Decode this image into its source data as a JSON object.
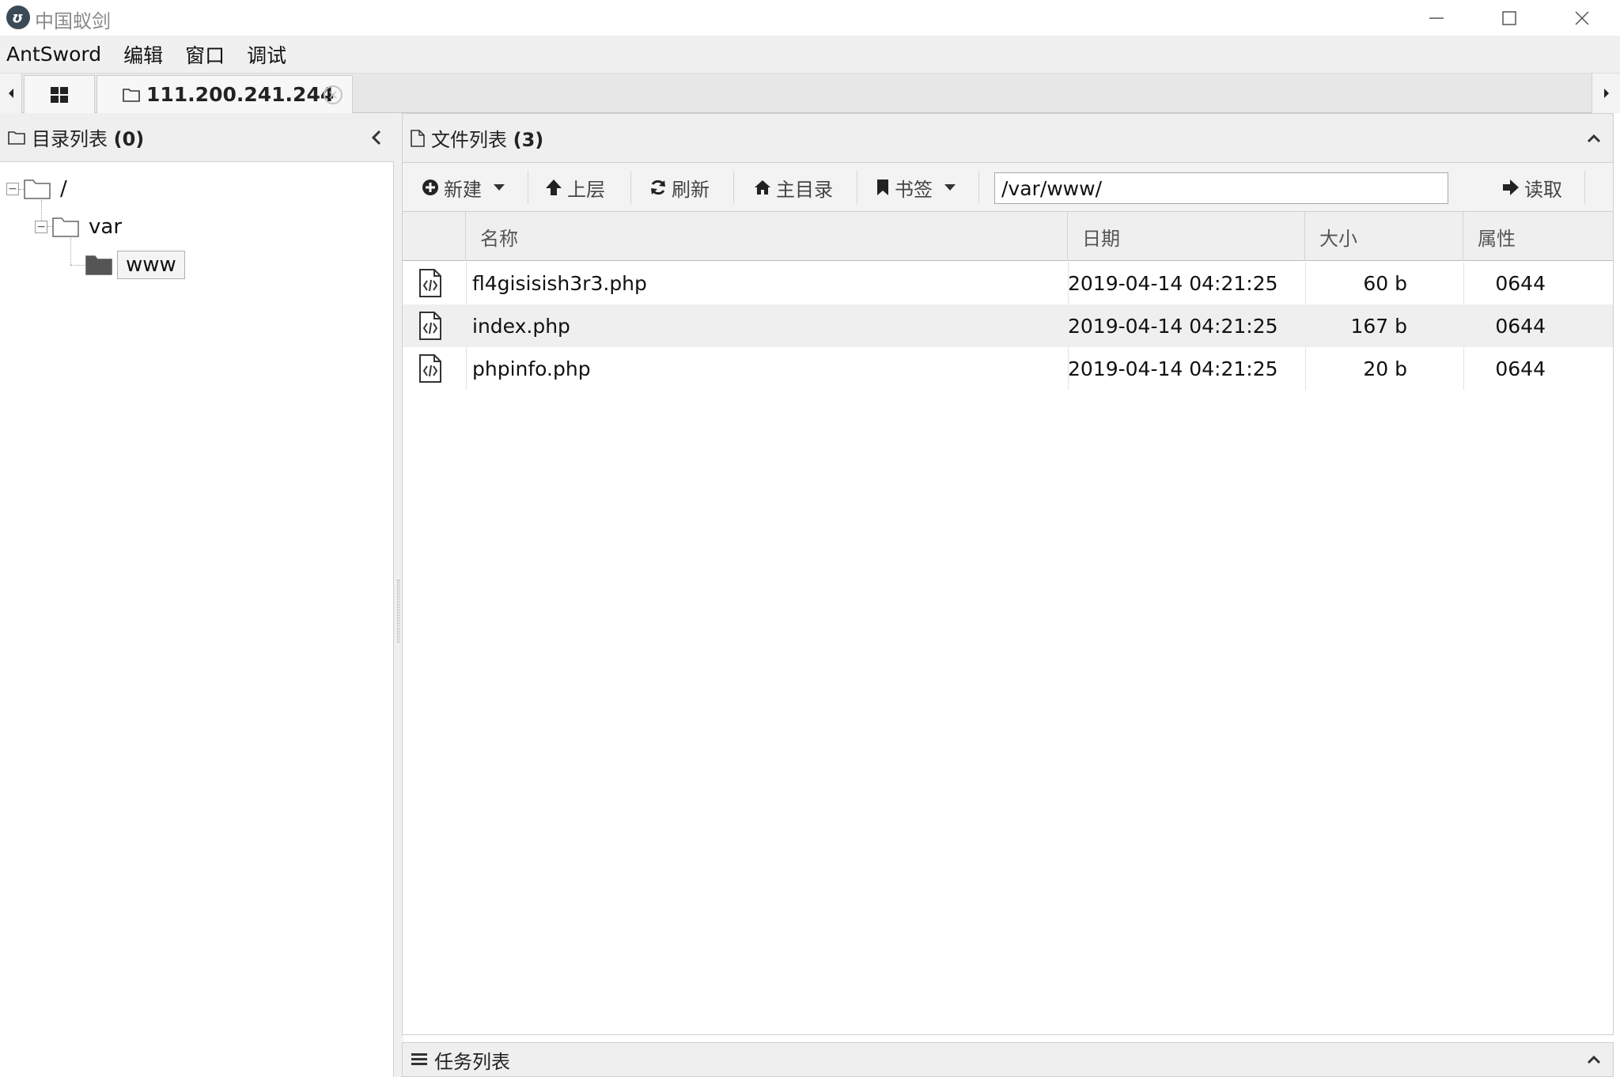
{
  "window": {
    "title": "中国蚁剑",
    "logo_glyph": "ʊ"
  },
  "menu": {
    "items": [
      "AntSword",
      "编辑",
      "窗口",
      "调试"
    ]
  },
  "tabs": {
    "host_label": "111.200.241.244",
    "close_glyph": "×"
  },
  "dir_panel": {
    "title": "目录列表",
    "count": "(0)",
    "tree": [
      {
        "label": "/",
        "level": 0
      },
      {
        "label": "var",
        "level": 1
      },
      {
        "label": "www",
        "level": 2,
        "selected": true
      }
    ]
  },
  "file_panel": {
    "title": "文件列表",
    "count": "(3)",
    "toolbar": {
      "new_label": "新建",
      "up_label": "上层",
      "refresh_label": "刷新",
      "home_label": "主目录",
      "bookmark_label": "书签",
      "path_value": "/var/www/",
      "read_label": "读取"
    },
    "columns": [
      "名称",
      "日期",
      "大小",
      "属性"
    ],
    "rows": [
      {
        "name": "fl4gisisish3r3.php",
        "date": "2019-04-14 04:21:25",
        "size": "60 b",
        "attr": "0644"
      },
      {
        "name": "index.php",
        "date": "2019-04-14 04:21:25",
        "size": "167 b",
        "attr": "0644"
      },
      {
        "name": "phpinfo.php",
        "date": "2019-04-14 04:21:25",
        "size": "20 b",
        "attr": "0644"
      }
    ]
  },
  "task_panel": {
    "title": "任务列表"
  }
}
